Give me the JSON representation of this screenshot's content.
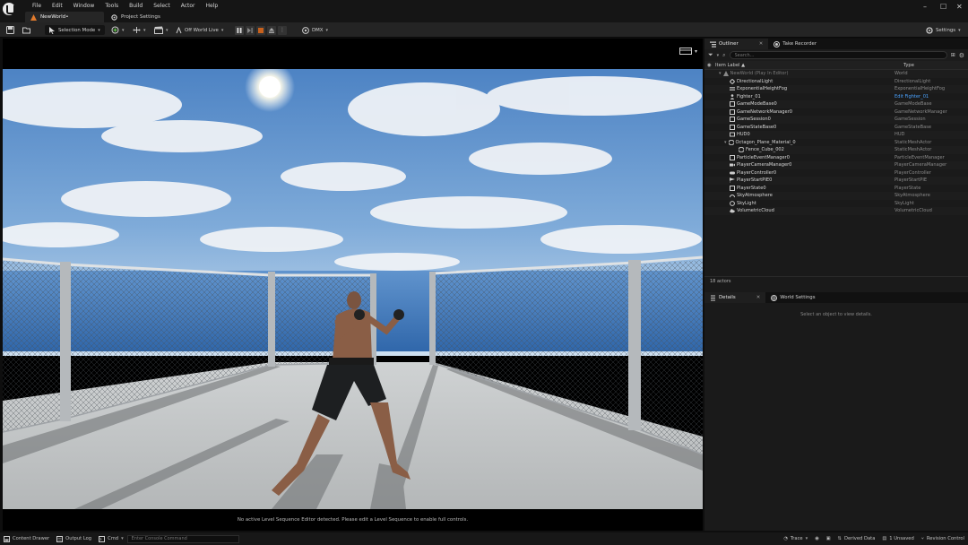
{
  "titlebar": {
    "menu": [
      "File",
      "Edit",
      "Window",
      "Tools",
      "Build",
      "Select",
      "Actor",
      "Help"
    ],
    "tab_world": "NewWorld•",
    "tab_project": "Project Settings"
  },
  "toolbar": {
    "selection_mode": "Selection Mode",
    "world_live": "Off World Live",
    "dmx": "DMX",
    "settings": "Settings"
  },
  "viewport": {
    "message": "No active Level Sequence Editor detected. Please edit a Level Sequence to enable full controls."
  },
  "outliner": {
    "tab_outliner": "Outliner",
    "tab_take_recorder": "Take Recorder",
    "search_placeholder": "Search...",
    "col_label": "Item Label ▲",
    "col_type": "Type",
    "items": [
      {
        "label": "NewWorld (Play In Editor)",
        "type": "World"
      },
      {
        "label": "DirectionalLight",
        "type": "DirectionalLight"
      },
      {
        "label": "ExponentialHeightFog",
        "type": "ExponentialHeightFog"
      },
      {
        "label": "Fighter_01",
        "type": "Edit Fighter_01"
      },
      {
        "label": "GameModeBase0",
        "type": "GameModeBase"
      },
      {
        "label": "GameNetworkManager0",
        "type": "GameNetworkManager"
      },
      {
        "label": "GameSession0",
        "type": "GameSession"
      },
      {
        "label": "GameStateBase0",
        "type": "GameStateBase"
      },
      {
        "label": "HUD0",
        "type": "HUD"
      },
      {
        "label": "Octagon_Plane_Material_0",
        "type": "StaticMeshActor"
      },
      {
        "label": "Fence_Cube_002",
        "type": "StaticMeshActor"
      },
      {
        "label": "ParticleEventManager0",
        "type": "ParticleEventManager"
      },
      {
        "label": "PlayerCameraManager0",
        "type": "PlayerCameraManager"
      },
      {
        "label": "PlayerController0",
        "type": "PlayerController"
      },
      {
        "label": "PlayerStartPIE0",
        "type": "PlayerStartPIE"
      },
      {
        "label": "PlayerState0",
        "type": "PlayerState"
      },
      {
        "label": "SkyAtmosphere",
        "type": "SkyAtmosphere"
      },
      {
        "label": "SkyLight",
        "type": "SkyLight"
      },
      {
        "label": "VolumetricCloud",
        "type": "VolumetricCloud"
      }
    ],
    "footer": "18 actors"
  },
  "details": {
    "tab_details": "Details",
    "tab_world_settings": "World Settings",
    "hint": "Select an object to view details."
  },
  "statusbar": {
    "content_drawer": "Content Drawer",
    "output_log": "Output Log",
    "cmd": "Cmd",
    "console_placeholder": "Enter Console Command",
    "trace": "Trace",
    "derived_data": "Derived Data",
    "unsaved": "1 Unsaved",
    "revision_control": "Revision Control"
  },
  "colors": {
    "accent": "#2a7de1",
    "link": "#4aa3ff",
    "stop": "#c7611d"
  }
}
